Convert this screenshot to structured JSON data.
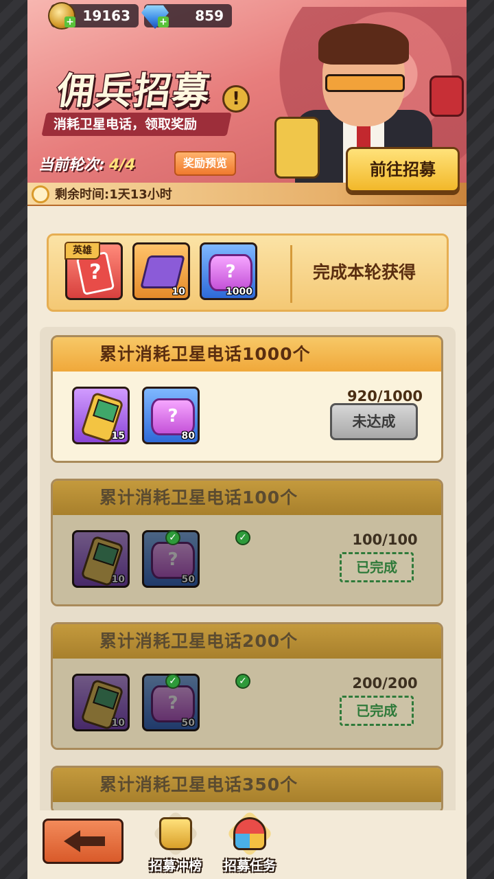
{
  "currency": {
    "gold": "19163",
    "gems": "859"
  },
  "banner": {
    "title": "佣兵招募",
    "subtitle": "消耗卫星电话，领取奖励",
    "round_label": "当前轮次:",
    "round_value": "4/4",
    "preview_button": "奖励预览",
    "go_button": "前往招募",
    "timer": "剩余时间:1天13小时"
  },
  "round_reward": {
    "hero_tag": "英雄",
    "items": [
      {
        "icon": "hero-card-icon",
        "count": ""
      },
      {
        "icon": "chip-icon",
        "count": "10"
      },
      {
        "icon": "mystery-can-icon",
        "count": "1000"
      }
    ],
    "label": "完成本轮获得"
  },
  "tasks": [
    {
      "title": "累计消耗卫星电话1000个",
      "rewards": [
        "15",
        "80"
      ],
      "progress": "920/1000",
      "status": "未达成"
    },
    {
      "title": "累计消耗卫星电话100个",
      "rewards": [
        "10",
        "50"
      ],
      "progress": "100/100",
      "status": "已完成"
    },
    {
      "title": "累计消耗卫星电话200个",
      "rewards": [
        "10",
        "50"
      ],
      "progress": "200/200",
      "status": "已完成"
    },
    {
      "title": "累计消耗卫星电话350个"
    }
  ],
  "nav": {
    "rank": "招募冲榜",
    "task": "招募任务"
  }
}
